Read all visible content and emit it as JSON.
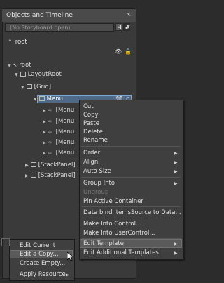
{
  "panel": {
    "title": "Objects and Timeline",
    "close": "×",
    "storyboard_placeholder": "(No Storyboard open)",
    "close_storyboard": "×",
    "add_storyboard": "+"
  },
  "tree": {
    "root_top": "root",
    "root": "root",
    "layout_root": "LayoutRoot",
    "grid": "[Grid]",
    "menu": "Menu",
    "menu_items": [
      "[Menu",
      "[Menu",
      "[Menu",
      "[Menu",
      "[Menu"
    ],
    "stack1": "[StackPanel]",
    "stack2": "[StackPanel]"
  },
  "context_menu": {
    "items": [
      {
        "label": "Cut",
        "enabled": true
      },
      {
        "label": "Copy",
        "enabled": true
      },
      {
        "label": "Paste",
        "enabled": true
      },
      {
        "label": "Delete",
        "enabled": true
      },
      {
        "label": "Rename",
        "enabled": true
      },
      {
        "label": "Order",
        "enabled": true,
        "submenu": true
      },
      {
        "label": "Align",
        "enabled": true,
        "submenu": true
      },
      {
        "label": "Auto Size",
        "enabled": true,
        "submenu": true
      },
      {
        "label": "Group Into",
        "enabled": true,
        "submenu": true
      },
      {
        "label": "Ungroup",
        "enabled": false
      },
      {
        "label": "Pin Active Container",
        "enabled": true
      },
      {
        "label": "Data bind ItemsSource to Data...",
        "enabled": true
      },
      {
        "label": "Make Into Control...",
        "enabled": true
      },
      {
        "label": "Make Into UserControl...",
        "enabled": true
      },
      {
        "label": "Edit Template",
        "enabled": true,
        "submenu": true,
        "highlighted": true
      },
      {
        "label": "Edit Additional Templates",
        "enabled": true,
        "submenu": true
      }
    ]
  },
  "template_submenu": {
    "items": [
      {
        "label": "Edit Current"
      },
      {
        "label": "Edit a Copy..."
      },
      {
        "label": "Create Empty..."
      },
      {
        "label": "Apply Resource"
      }
    ]
  }
}
